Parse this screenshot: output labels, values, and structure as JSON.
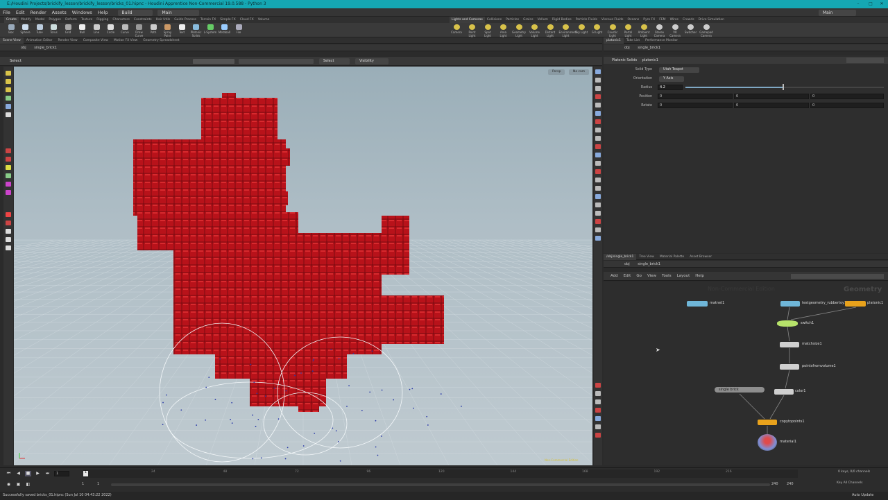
{
  "window": {
    "title": "E:/Houdini Projects/brickify_lesson/brickify_lesson/bricks_01.hipnc - Houdini Apprentice Non-Commercial 19.0.588 - Python 3",
    "desktop": "Main"
  },
  "menu": [
    "File",
    "Edit",
    "Render",
    "Assets",
    "Windows",
    "Help"
  ],
  "build_desktop": "Build",
  "main_desktop": "Main",
  "shelf_tabs_left": [
    "Create",
    "Modify",
    "Model",
    "Polygon",
    "Deform",
    "Texture",
    "Rigging",
    "Characters",
    "Constraints",
    "Hair Utils",
    "Guide Process",
    "Terrain FX",
    "Simple FX",
    "Cloud FX",
    "Volume"
  ],
  "shelf_tabs_right": [
    "Lights and Cameras",
    "Collisions",
    "Particles",
    "Grains",
    "Vellum",
    "Rigid Bodies",
    "Particle Fluids",
    "Viscous Fluids",
    "Oceans",
    "Pyro FX",
    "FEM",
    "Wires",
    "Crowds",
    "Drive Simulation"
  ],
  "tools_left": [
    "Box",
    "Sphere",
    "Tube",
    "Torus",
    "Grid",
    "Null",
    "Line",
    "Circle",
    "Curve",
    "Draw Curve",
    "Path",
    "Spray Paint",
    "Text",
    "Platonic Solids",
    "L-System",
    "Metaball",
    "File"
  ],
  "tools_right": [
    "Camera",
    "Point Light",
    "Spot Light",
    "Area Light",
    "Geometry Light",
    "Volume Light",
    "Distant Light",
    "Environment Light",
    "Sky Light",
    "GI Light",
    "Caustic Light",
    "Portal Light",
    "Ambient Light",
    "Stereo Camera",
    "VR Camera",
    "Switcher",
    "Gamepad Camera"
  ],
  "left_pane_tabs": [
    "Scene View",
    "Animation Editor",
    "Render View",
    "Composite View",
    "Motion FX View",
    "Geometry Spreadsheet"
  ],
  "right_pane_tabs": [
    "platonic1",
    "Take List",
    "Performance Monitor"
  ],
  "left_path": {
    "root": "obj",
    "node": "single_brick1"
  },
  "right_path": {
    "root": "obj",
    "node": "single_brick1"
  },
  "viewport": {
    "mode": "Select",
    "select_menu": "Select",
    "visibility_menu": "Visibility",
    "camera": "Persp",
    "cam_menu": "No cam",
    "watermark": "Non-Commercial Edition"
  },
  "params": {
    "node_type": "Platonic Solids",
    "node_name": "platonic1",
    "solid_type_label": "Solid Type",
    "solid_type_value": "Utah Teapot",
    "orientation_label": "Orientation",
    "orientation_value": "Y Axis",
    "radius_label": "Radius",
    "radius_value": "4.2",
    "radius_fraction": 0.49,
    "position_label": "Position",
    "position_values": [
      "0",
      "0",
      "0"
    ],
    "rotate_label": "Rotate",
    "rotate_values": [
      "0",
      "0",
      "0"
    ]
  },
  "network_tabs": [
    "/obj/single_brick1",
    "Tree View",
    "Material Palette",
    "Asset Browser"
  ],
  "network_path": {
    "root": "obj",
    "node": "single_brick1"
  },
  "network_menu": [
    "Add",
    "Edit",
    "Go",
    "View",
    "Tools",
    "Layout",
    "Help"
  ],
  "network": {
    "watermark": "Non-Commercial Edition",
    "context": "Geometry",
    "nodes": {
      "matnet": "matnet1",
      "testgeo": "testgeometry_rubbertoy1",
      "platonic": "platonic1",
      "switch": "switch1",
      "matchsize": "matchsize1",
      "pointsfromvolume": "pointsfromvolume1",
      "singlebrick": "single brick",
      "color": "color1",
      "copytopoints": "copytopoints1",
      "material": "material1"
    }
  },
  "timeline": {
    "current_frame": "1",
    "start": "1",
    "start2": "1",
    "ticks": [
      "24",
      "48",
      "72",
      "96",
      "120",
      "144",
      "168",
      "192",
      "216"
    ],
    "end": "240",
    "end2": "240",
    "keys_label": "0 keys, 0/0 channels",
    "key_channels": "Key All Channels",
    "auto_update": "Auto Update"
  },
  "status": "Successfully saved bricks_01.hipnc (Sun Jul 10 04:43:22 2022)",
  "colors": {
    "brick": "#b8121a",
    "teal": "#15a7b3",
    "node_yellow": "#e8a21c",
    "node_blue": "#6fb6d8"
  }
}
